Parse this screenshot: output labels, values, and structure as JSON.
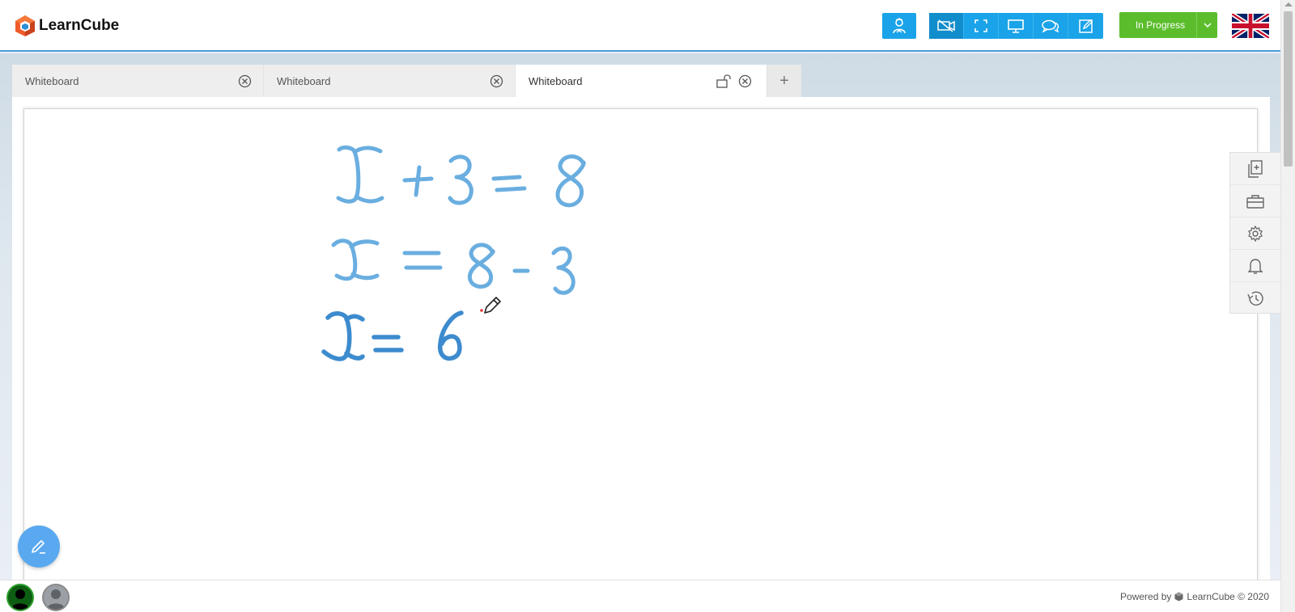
{
  "app": {
    "logo_text": "LearnCube",
    "brand_color": "#ee5a2a",
    "accent_color": "#1aa3e8",
    "status_color": "#5bbd2c"
  },
  "header": {
    "teacher_button_icon": "teacher-icon",
    "toolbar_icons": [
      "video-off-icon",
      "fullscreen-icon",
      "screen-share-icon",
      "chat-icon",
      "whiteboard-edit-icon"
    ],
    "status_label": "In Progress",
    "language_flag": "uk-flag"
  },
  "tabs": [
    {
      "label": "Whiteboard",
      "active": false
    },
    {
      "label": "Whiteboard",
      "active": false
    },
    {
      "label": "Whiteboard",
      "active": true
    }
  ],
  "tab_add_label": "+",
  "board": {
    "handwriting": [
      "x + 3 = 8",
      "x = 8 - 3",
      "x = 6"
    ],
    "ink_color": "#5fa8dc"
  },
  "tool_panel": [
    "add-page-icon",
    "toolbox-icon",
    "settings-icon",
    "notification-bell-icon",
    "history-icon"
  ],
  "footer": {
    "powered_by": "Powered by",
    "brand": "LearnCube © 2020"
  }
}
